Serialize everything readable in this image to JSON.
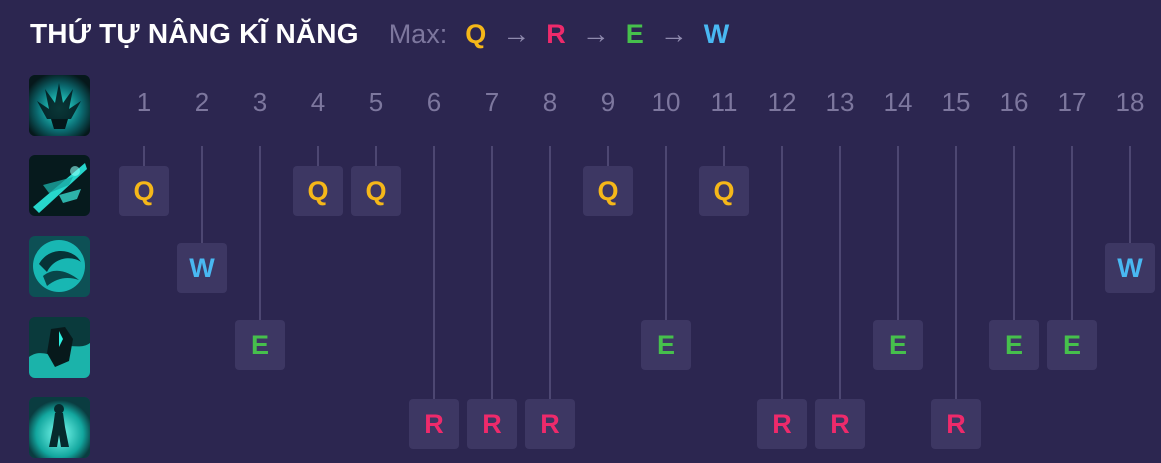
{
  "header": {
    "title": "THỨ TỰ NÂNG KĨ NĂNG",
    "max_label": "Max:",
    "sequence": [
      "Q",
      "R",
      "E",
      "W"
    ],
    "arrow": "→"
  },
  "colors": {
    "Q": "#f5b719",
    "W": "#49b8f2",
    "E": "#46c04c",
    "R": "#ee2a6b"
  },
  "icons": [
    "passive-icon",
    "skill-q-icon",
    "skill-w-icon",
    "skill-e-icon",
    "skill-r-icon"
  ],
  "levels": [
    "1",
    "2",
    "3",
    "4",
    "5",
    "6",
    "7",
    "8",
    "9",
    "10",
    "11",
    "12",
    "13",
    "14",
    "15",
    "16",
    "17",
    "18"
  ],
  "skill_order": [
    "Q",
    "W",
    "E",
    "Q",
    "Q",
    "R",
    "R",
    "R",
    "Q",
    "E",
    "Q",
    "R",
    "R",
    "E",
    "R",
    "E",
    "E",
    "W"
  ]
}
